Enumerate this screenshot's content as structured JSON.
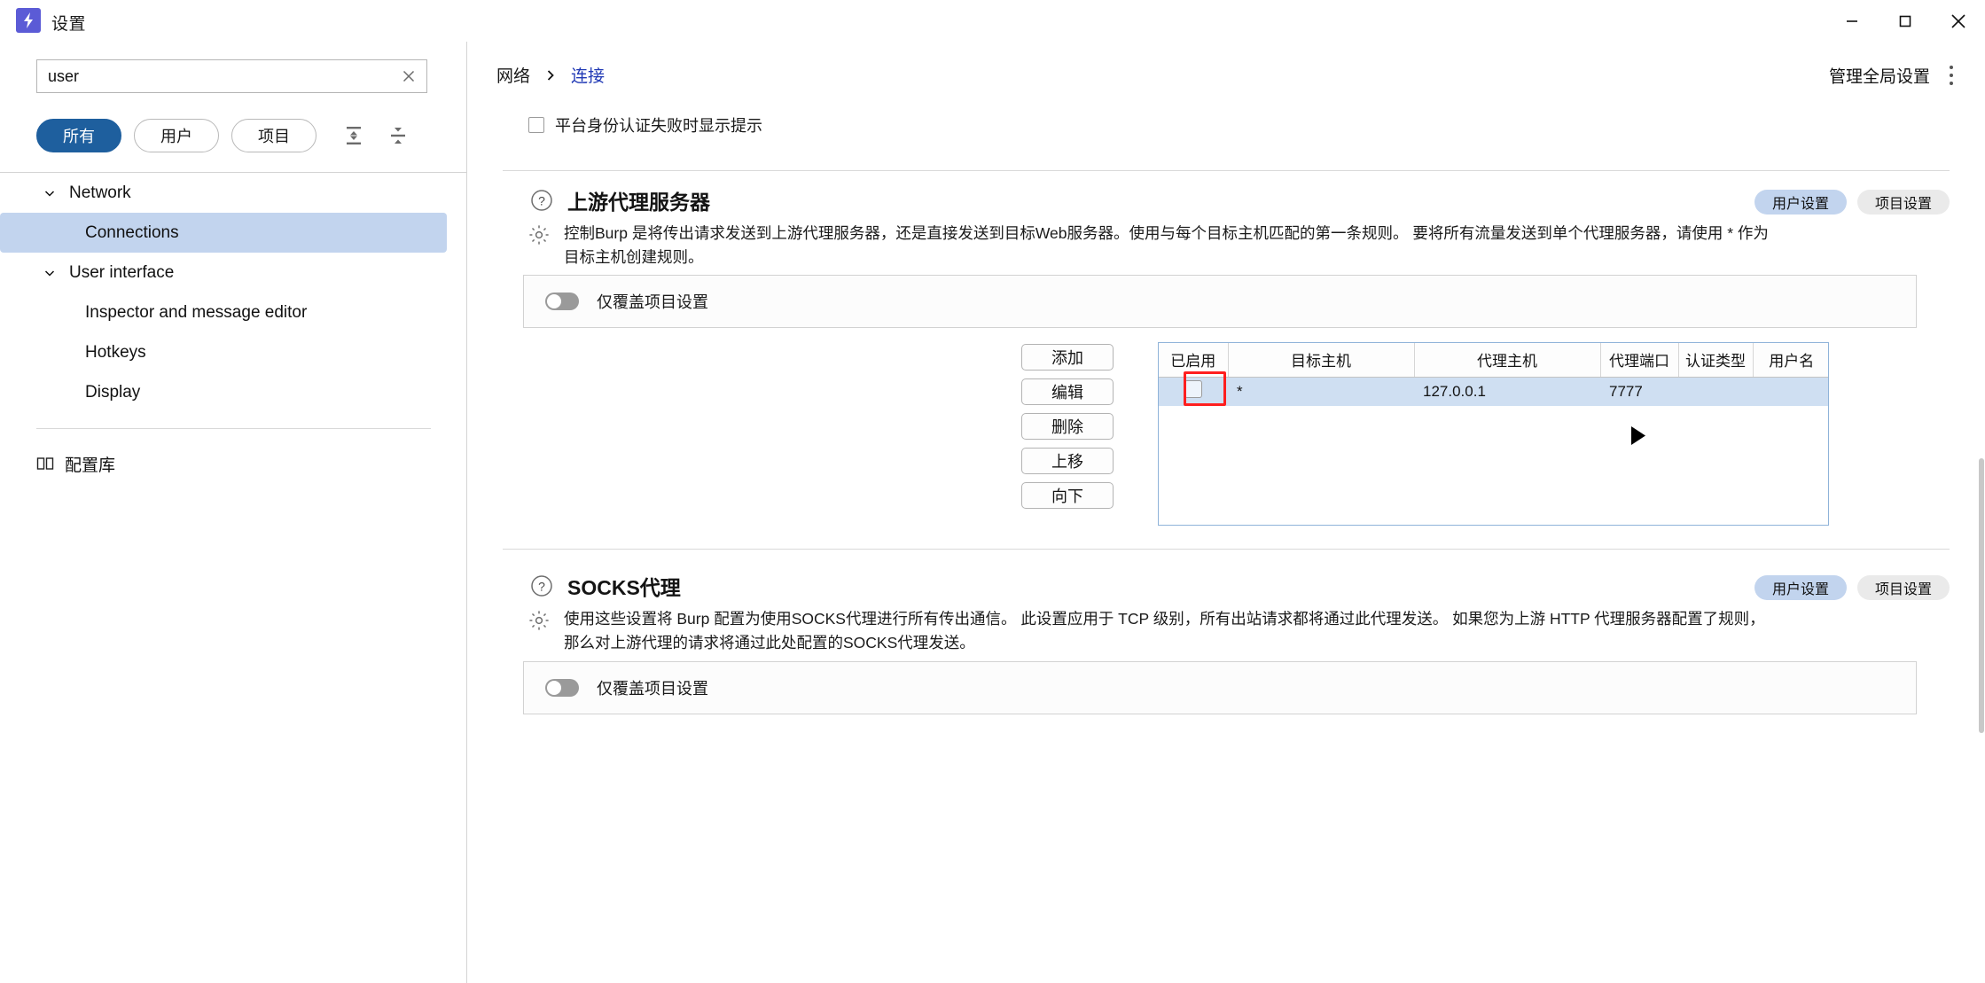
{
  "window": {
    "title": "设置",
    "logo_icon": "bolt-icon",
    "controls": {
      "minimize": "minimize-icon",
      "maximize": "maximize-icon",
      "close": "close-icon"
    }
  },
  "sidebar": {
    "search": {
      "value": "user",
      "placeholder": "",
      "clear_icon": "close-icon",
      "search_icon": "search-icon"
    },
    "filters": [
      {
        "label": "所有",
        "active": true
      },
      {
        "label": "用户",
        "active": false
      },
      {
        "label": "项目",
        "active": false
      }
    ],
    "filter_icons": [
      {
        "name": "expand-all-icon"
      },
      {
        "name": "collapse-all-icon"
      }
    ],
    "tree": [
      {
        "type": "group",
        "label": "Network",
        "expanded": true,
        "caret": "chevron-down-icon"
      },
      {
        "type": "item",
        "label": "Connections",
        "selected": true
      },
      {
        "type": "group",
        "label": "User interface",
        "expanded": true,
        "caret": "chevron-down-icon"
      },
      {
        "type": "item",
        "label": "Inspector and message editor",
        "selected": false
      },
      {
        "type": "item",
        "label": "Hotkeys",
        "selected": false
      },
      {
        "type": "item",
        "label": "Display",
        "selected": false
      }
    ],
    "library": {
      "label": "配置库",
      "icon": "book-icon"
    }
  },
  "header": {
    "breadcrumb": [
      {
        "label": "网络",
        "link": false
      },
      {
        "label": "连接",
        "link": true
      }
    ],
    "breadcrumb_separator_icon": "chevron-right-icon",
    "global_settings_label": "管理全局设置",
    "kebab_icon": "more-vertical-icon"
  },
  "content": {
    "top_checkbox": {
      "label": "平台身份认证失败时显示提示",
      "checked": false
    },
    "sections": [
      {
        "id": "upstream-proxy",
        "title": "上游代理服务器",
        "help_icon": "question-circle-icon",
        "gear_icon": "gear-icon",
        "badges": [
          {
            "label": "用户设置",
            "kind": "user"
          },
          {
            "label": "项目设置",
            "kind": "project"
          }
        ],
        "description_line1": "控制Burp 是将传出请求发送到上游代理服务器，还是直接发送到目标Web服务器。使用与每个目标主机匹配的第一条规则。 要将所有流量发送到单个代理服务器，请使用 * 作为",
        "description_line2": "目标主机创建规则。",
        "override": {
          "label": "仅覆盖项目设置",
          "enabled": false
        },
        "buttons": [
          {
            "label": "添加"
          },
          {
            "label": "编辑"
          },
          {
            "label": "删除"
          },
          {
            "label": "上移"
          },
          {
            "label": "向下"
          }
        ],
        "table": {
          "columns": [
            "已启用",
            "目标主机",
            "代理主机",
            "代理端口",
            "认证类型",
            "用户名"
          ],
          "rows": [
            {
              "enabled": false,
              "target_host": "*",
              "proxy_host": "127.0.0.1",
              "proxy_port": "7777",
              "auth_type": "",
              "username": "",
              "selected": true
            }
          ]
        }
      },
      {
        "id": "socks-proxy",
        "title": "SOCKS代理",
        "help_icon": "question-circle-icon",
        "gear_icon": "gear-icon",
        "badges": [
          {
            "label": "用户设置",
            "kind": "user"
          },
          {
            "label": "项目设置",
            "kind": "project"
          }
        ],
        "description_line1": "使用这些设置将 Burp 配置为使用SOCKS代理进行所有传出通信。 此设置应用于 TCP 级别，所有出站请求都将通过此代理发送。 如果您为上游 HTTP 代理服务器配置了规则，",
        "description_line2": "那么对上游代理的请求将通过此处配置的SOCKS代理发送。",
        "override": {
          "label": "仅覆盖项目设置",
          "enabled": false
        }
      }
    ],
    "annotation": {
      "highlight_target": "enabled-checkbox",
      "cursor_icon": "pointer-arrow-icon"
    }
  }
}
